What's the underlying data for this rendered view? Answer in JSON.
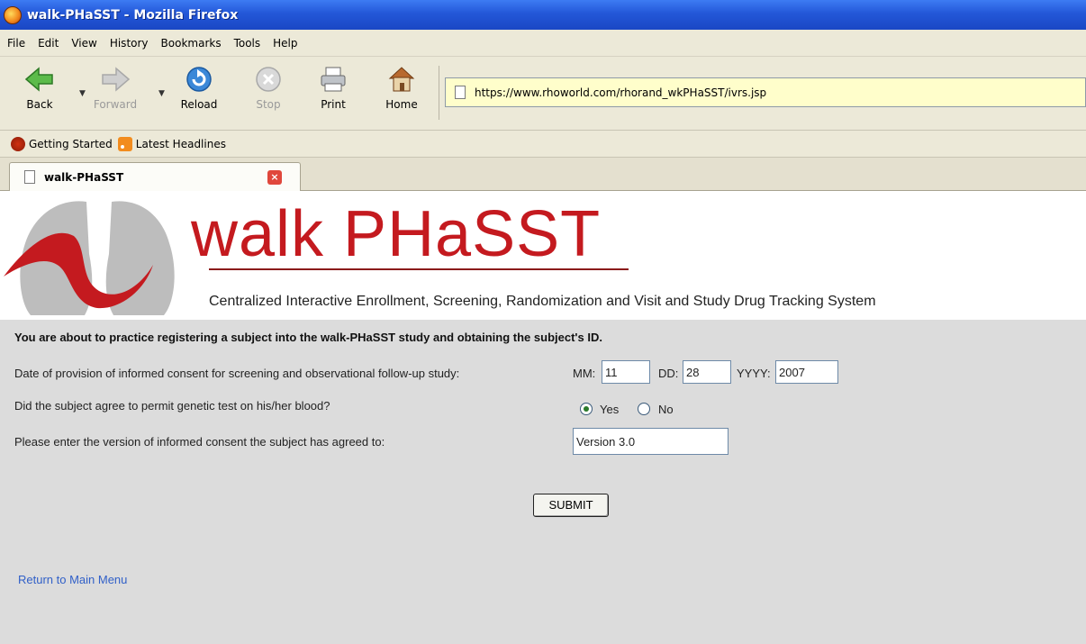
{
  "window": {
    "title": "walk-PHaSST - Mozilla Firefox"
  },
  "menu": [
    "File",
    "Edit",
    "View",
    "History",
    "Bookmarks",
    "Tools",
    "Help"
  ],
  "toolbar": {
    "back": "Back",
    "forward": "Forward",
    "reload": "Reload",
    "stop": "Stop",
    "print": "Print",
    "home": "Home"
  },
  "address": {
    "url": "https://www.rhoworld.com/rhorand_wkPHaSST/ivrs.jsp"
  },
  "bookmarks": [
    {
      "label": "Getting Started",
      "icon": "getting-started-icon"
    },
    {
      "label": "Latest Headlines",
      "icon": "rss-icon"
    }
  ],
  "tab": {
    "title": "walk-PHaSST"
  },
  "header": {
    "brand": "walk PHaSST",
    "subtitle": "Centralized Interactive Enrollment, Screening, Randomization and Visit and Study Drug Tracking System"
  },
  "form": {
    "intro": "You are about to practice registering a subject into the walk-PHaSST study and obtaining the subject's ID.",
    "consent_date_label": "Date of provision of informed consent for screening and observational follow-up study:",
    "mm_label": "MM:",
    "mm_value": "11",
    "dd_label": "DD:",
    "dd_value": "28",
    "yyyy_label": "YYYY:",
    "yyyy_value": "2007",
    "genetic_label": "Did the subject agree to permit genetic test on his/her blood?",
    "yes_label": "Yes",
    "no_label": "No",
    "genetic_selected": "Yes",
    "version_label": "Please enter the version of informed consent the subject has agreed to:",
    "version_value": "Version 3.0",
    "submit": "SUBMIT",
    "return_link": "Return to Main Menu"
  },
  "colors": {
    "brand_red": "#c41a1f",
    "form_bg": "#dcdcdc",
    "link": "#3160c8",
    "titlebar": "#2357d8"
  }
}
